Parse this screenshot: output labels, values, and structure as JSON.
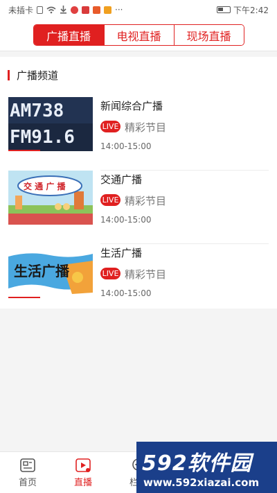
{
  "status_bar": {
    "carrier": "未插卡",
    "time": "下午2:42",
    "more": "···"
  },
  "tabs": [
    {
      "label": "广播直播",
      "active": true
    },
    {
      "label": "电视直播",
      "active": false
    },
    {
      "label": "现场直播",
      "active": false
    }
  ],
  "section": {
    "title": "广播频道"
  },
  "channels": [
    {
      "title": "新闻综合广播",
      "badge": "LIVE",
      "program": "精彩节目",
      "time": "14:00-15:00",
      "thumb_text": [
        "AM738",
        "FM91.6"
      ]
    },
    {
      "title": "交通广播",
      "badge": "LIVE",
      "program": "精彩节目",
      "time": "14:00-15:00",
      "thumb_text": [
        "交 通 广 播"
      ]
    },
    {
      "title": "生活广播",
      "badge": "LIVE",
      "program": "精彩节目",
      "time": "14:00-15:00",
      "thumb_text": [
        "生活广播"
      ]
    }
  ],
  "bottom_nav": [
    {
      "label": "首页",
      "icon": "news-icon",
      "active": false
    },
    {
      "label": "直播",
      "icon": "live-play-icon",
      "active": true
    },
    {
      "label": "栏目",
      "icon": "chat-icon",
      "active": false
    }
  ],
  "watermark": {
    "brand": "592软件园",
    "url": "www.592xiazai.com"
  },
  "colors": {
    "accent": "#e02020",
    "background": "#f4f4f4"
  }
}
